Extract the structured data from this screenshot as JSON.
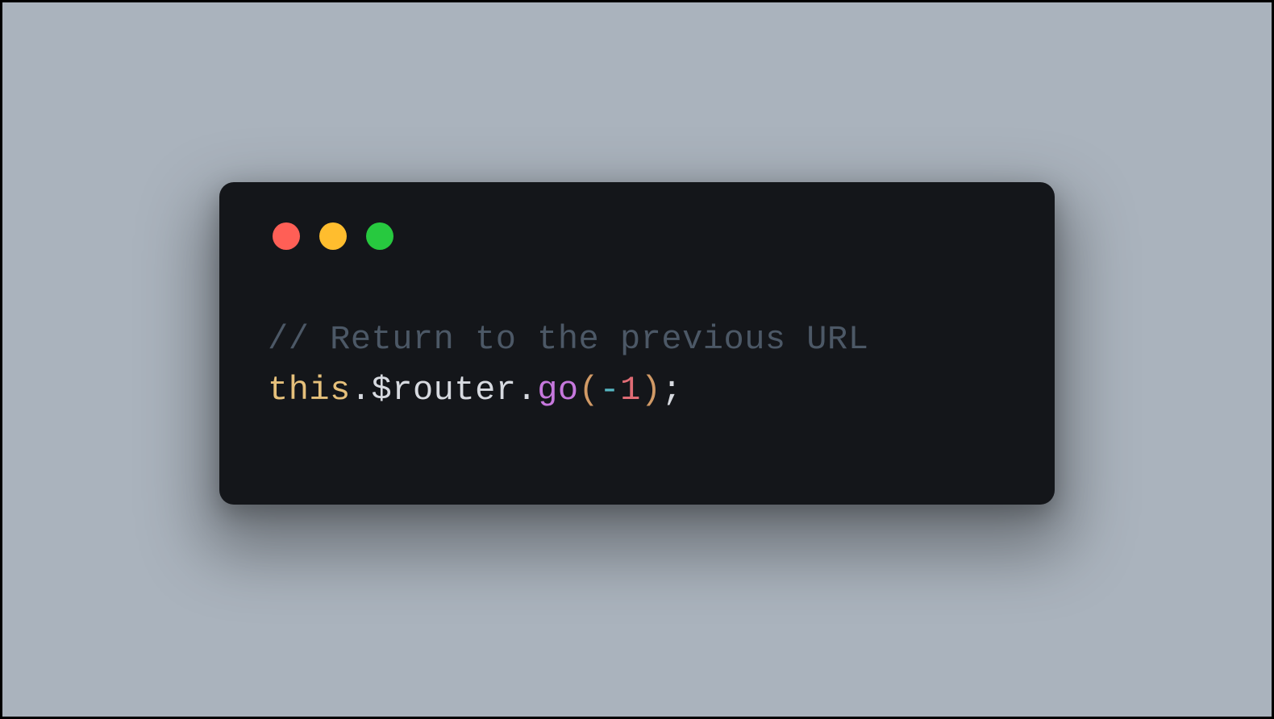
{
  "code": {
    "comment": "// Return to the previous URL",
    "line2": {
      "this": "this",
      "dot1": ".",
      "router": "$router",
      "dot2": ".",
      "go": "go",
      "lparen": "(",
      "minus": "-",
      "number": "1",
      "rparen": ")",
      "semi": ";"
    }
  },
  "colors": {
    "background": "#aab3bd",
    "window": "#14161a",
    "red": "#ff5f56",
    "yellow": "#ffbd2e",
    "green": "#27c93f"
  }
}
